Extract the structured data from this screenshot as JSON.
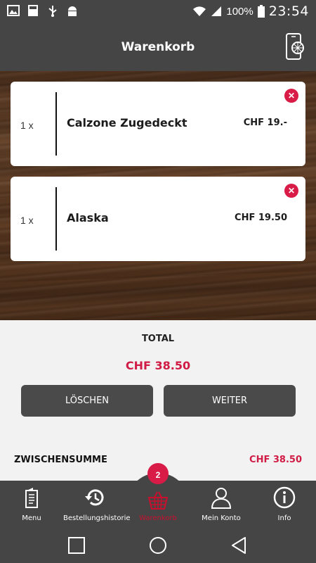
{
  "status_bar": {
    "battery": "100%",
    "time": "23:54"
  },
  "header": {
    "title": "Warenkorb"
  },
  "cart": {
    "items": [
      {
        "qty": "1 x",
        "name": "Calzone Zugedeckt",
        "price": "CHF 19.-"
      },
      {
        "qty": "1 x",
        "name": "Alaska",
        "price": "CHF 19.50"
      }
    ]
  },
  "summary": {
    "total_label": "TOTAL",
    "total_value": "CHF 38.50",
    "delete_label": "LÖSCHEN",
    "next_label": "WEITER",
    "subtotal_label": "ZWISCHENSUMME",
    "subtotal_value": "CHF 38.50"
  },
  "bottom_nav": {
    "badge_count": "2",
    "items": [
      {
        "label": "Menu",
        "icon": "menu-card-icon"
      },
      {
        "label": "Bestellungshistorie",
        "icon": "history-icon"
      },
      {
        "label": "Warenkorb",
        "icon": "basket-icon"
      },
      {
        "label": "Mein Konto",
        "icon": "user-icon"
      },
      {
        "label": "Info",
        "icon": "info-icon"
      }
    ]
  },
  "colors": {
    "bar": "#454545",
    "accent": "#d81b47"
  }
}
